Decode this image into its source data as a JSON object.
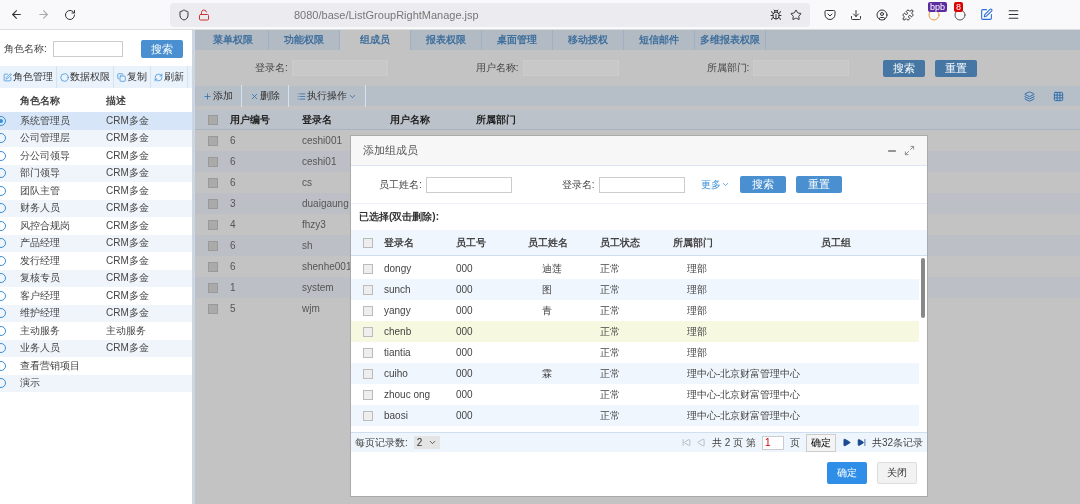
{
  "browser": {
    "url": "8080/base/ListGroupRightManage.jsp",
    "badges": [
      {
        "kind": "bpb",
        "text": "bpb"
      },
      {
        "kind": "count",
        "text": "8"
      }
    ]
  },
  "sidebar": {
    "search_label": "角色名称:",
    "search_button": "搜索",
    "toolbar": [
      {
        "kind": "edit",
        "label": "角色管理"
      },
      {
        "kind": "ring",
        "label": "数据权限"
      },
      {
        "kind": "copy",
        "label": "复制"
      },
      {
        "kind": "refresh",
        "label": "刷新"
      }
    ],
    "columns": [
      "角色名称",
      "描述"
    ],
    "rows": [
      {
        "name": "系统管理员",
        "desc": "CRM多金",
        "selected": true
      },
      {
        "name": "公司管理层",
        "desc": "CRM多金",
        "selected": false
      },
      {
        "name": "分公司领导",
        "desc": "CRM多金",
        "selected": false
      },
      {
        "name": "部门领导",
        "desc": "CRM多金",
        "selected": false
      },
      {
        "name": "团队主管",
        "desc": "CRM多金",
        "selected": false
      },
      {
        "name": "财务人员",
        "desc": "CRM多金",
        "selected": false
      },
      {
        "name": "风控合规岗",
        "desc": "CRM多金",
        "selected": false
      },
      {
        "name": "产品经理",
        "desc": "CRM多金",
        "selected": false
      },
      {
        "name": "发行经理",
        "desc": "CRM多金",
        "selected": false
      },
      {
        "name": "复核专员",
        "desc": "CRM多金",
        "selected": false
      },
      {
        "name": "客户经理",
        "desc": "CRM多金",
        "selected": false
      },
      {
        "name": "维护经理",
        "desc": "CRM多金",
        "selected": false
      },
      {
        "name": "主动服务",
        "desc": "主动服务",
        "selected": false
      },
      {
        "name": "业务人员",
        "desc": "CRM多金",
        "selected": false
      },
      {
        "name": "查看营销项目",
        "selected": false
      },
      {
        "name": "演示",
        "selected": false
      }
    ]
  },
  "tabs": [
    {
      "label": "菜单权限",
      "selected": false
    },
    {
      "label": "功能权限",
      "selected": false
    },
    {
      "label": "组成员",
      "selected": true
    },
    {
      "label": "报表权限",
      "selected": false
    },
    {
      "label": "桌面管理",
      "selected": false
    },
    {
      "label": "移动授权",
      "selected": false
    },
    {
      "label": "短信邮件",
      "selected": false
    },
    {
      "label": "多维报表权限",
      "selected": false
    }
  ],
  "filters": [
    {
      "label": "登录名:"
    },
    {
      "label": "用户名称:"
    },
    {
      "label": "所属部门:"
    }
  ],
  "filter_buttons": [
    "搜索",
    "重置"
  ],
  "toolbar": [
    {
      "kind": "add",
      "label": "添加"
    },
    {
      "kind": "delete",
      "label": "删除"
    },
    {
      "kind": "list",
      "label": "执行操作"
    }
  ],
  "table": {
    "columns": [
      "用户编号",
      "登录名",
      "用户名称",
      "所属部门"
    ],
    "all_checked": false,
    "rows": [
      {
        "id": "6",
        "login": "ceshi001",
        "checked": false
      },
      {
        "id": "6",
        "login": "ceshi01",
        "checked": false
      },
      {
        "id": "6",
        "login": "cs",
        "checked": false
      },
      {
        "id": "3",
        "login": "duaigaung",
        "checked": false
      },
      {
        "id": "4",
        "login": "fhzy3",
        "checked": false
      },
      {
        "id": "6",
        "login": "sh",
        "checked": false
      },
      {
        "id": "6",
        "login": "shenhe001",
        "checked": false
      },
      {
        "id": "1",
        "login": "system",
        "checked": false
      },
      {
        "id": "5",
        "login": "wjm",
        "checked": false
      }
    ]
  },
  "dialog": {
    "title": "添加组成员",
    "filters": [
      {
        "label": "员工姓名:"
      },
      {
        "label": "登录名:"
      }
    ],
    "more": "更多",
    "buttons": [
      "搜索",
      "重置"
    ],
    "selected_label": "已选择(双击删除):",
    "all_checked": false,
    "columns": [
      "登录名",
      "员工号",
      "员工姓名",
      "员工状态",
      "所属部门",
      "员工组"
    ],
    "rows": [
      {
        "login": "dongy",
        "no": "000",
        "name": "迪莲",
        "status": "正常",
        "dept": "理部",
        "selected": false
      },
      {
        "login": "sunch",
        "no": "000",
        "name": "图",
        "status": "正常",
        "dept": "理部",
        "selected": false
      },
      {
        "login": "yangy",
        "no": "000",
        "name": "青",
        "status": "正常",
        "dept": "理部",
        "selected": false
      },
      {
        "login": "chenb",
        "no": "000",
        "status": "正常",
        "dept": "理部",
        "selected": true
      },
      {
        "login": "tiantia",
        "no": "000",
        "status": "正常",
        "dept": "理部",
        "selected": false
      },
      {
        "login": "cuiho",
        "no": "000",
        "name": "霖",
        "status": "正常",
        "dept": "理中心-北京财富管理中心",
        "selected": false
      },
      {
        "login": "zhouc    ong",
        "no": "000",
        "status": "正常",
        "dept": "理中心-北京财富管理中心",
        "selected": false
      },
      {
        "login": "baosi",
        "no": "000",
        "status": "正常",
        "dept": "理中心-北京财富管理中心",
        "selected": false
      }
    ],
    "pager": {
      "per_page_label": "每页记录数:",
      "per_page": "2",
      "total_pages": "共 2 页 第",
      "page": "1",
      "page_suffix": "页",
      "go": "确定",
      "total": "共32条记录"
    },
    "footer_buttons": [
      {
        "kind": "primary",
        "label": "确定"
      },
      {
        "kind": "secondary",
        "label": "关闭"
      }
    ]
  }
}
